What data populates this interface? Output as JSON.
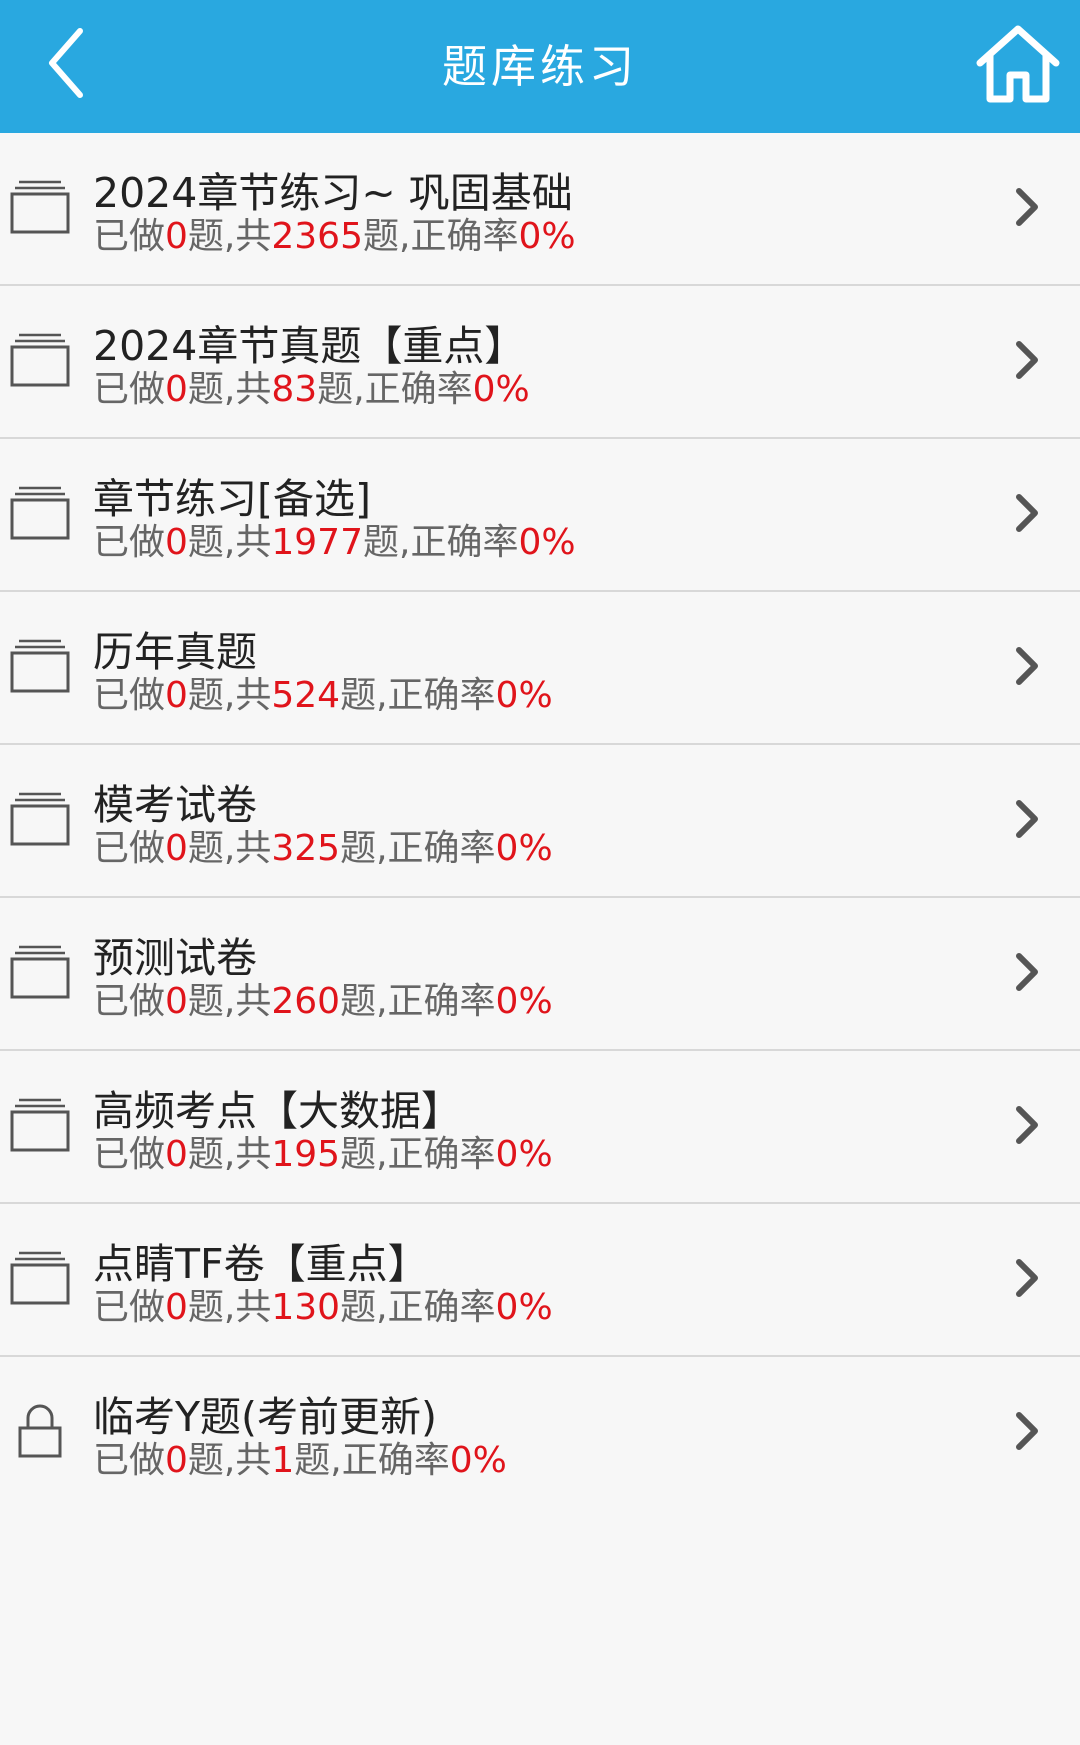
{
  "header": {
    "title": "题库练习",
    "back_icon": "back-chevron-icon",
    "home_icon": "home-icon",
    "background_color": "#29a8e0"
  },
  "stats_template": {
    "done_prefix": "已做",
    "done_suffix": "题,共",
    "total_suffix": "题,正确率"
  },
  "accent_color": "#e0141b",
  "items": [
    {
      "title": "2024章节练习~ 巩固基础",
      "done": "0",
      "total": "2365",
      "accuracy": "0%",
      "icon": "folder-icon"
    },
    {
      "title": "2024章节真题【重点】",
      "done": "0",
      "total": "83",
      "accuracy": "0%",
      "icon": "folder-icon"
    },
    {
      "title": "章节练习[备选]",
      "done": "0",
      "total": "1977",
      "accuracy": "0%",
      "icon": "folder-icon"
    },
    {
      "title": "历年真题",
      "done": "0",
      "total": "524",
      "accuracy": "0%",
      "icon": "folder-icon"
    },
    {
      "title": "模考试卷",
      "done": "0",
      "total": "325",
      "accuracy": "0%",
      "icon": "folder-icon"
    },
    {
      "title": "预测试卷",
      "done": "0",
      "total": "260",
      "accuracy": "0%",
      "icon": "folder-icon"
    },
    {
      "title": "高频考点【大数据】",
      "done": "0",
      "total": "195",
      "accuracy": "0%",
      "icon": "folder-icon"
    },
    {
      "title": "点睛TF卷【重点】",
      "done": "0",
      "total": "130",
      "accuracy": "0%",
      "icon": "folder-icon"
    },
    {
      "title": "临考Y题(考前更新)",
      "done": "0",
      "total": "1",
      "accuracy": "0%",
      "icon": "lock-icon"
    }
  ]
}
